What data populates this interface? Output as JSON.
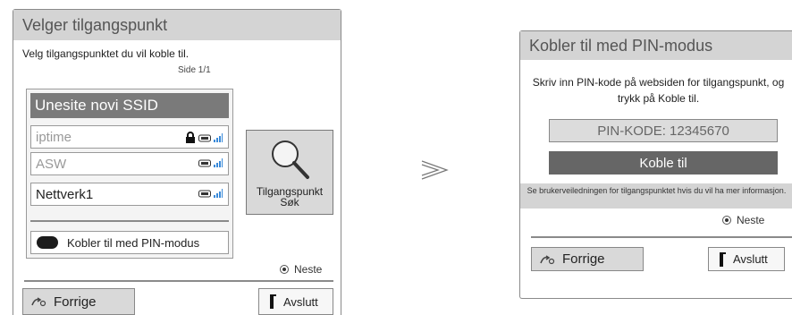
{
  "left_dialog": {
    "title": "Velger tilgangspunkt",
    "prompt": "Velg tilgangspunktet du vil koble til.",
    "page_indicator": "Side 1/1",
    "selected_item": "Unesite novi SSID",
    "access_points": [
      {
        "name": "iptime",
        "locked": true
      },
      {
        "name": "ASW",
        "locked": false
      },
      {
        "name": "Nettverk1",
        "locked": false
      }
    ],
    "pin_mode_button": "Kobler til med PIN-modus",
    "search_button_line1": "Tilgangspunkt",
    "search_button_line2": "Søk",
    "next_label": "Neste",
    "back_button": "Forrige",
    "exit_button": "Avslutt"
  },
  "arrow_glyph": "⪢",
  "right_dialog": {
    "title": "Kobler til med PIN-modus",
    "instruction": "Skriv inn PIN-kode på websiden for tilgangspunkt, og trykk på Koble til.",
    "pin_field": "PIN-KODE: 12345670",
    "connect_button": "Koble til",
    "help_text": "Se brukerveiledningen for tilgangspunktet hvis du vil ha mer informasjon.",
    "next_label": "Neste",
    "back_button": "Forrige",
    "exit_button": "Avslutt"
  },
  "icons": [
    "lock-icon",
    "router-icon",
    "signal-icon",
    "search-icon",
    "remote-back-icon",
    "exit-bracket-icon",
    "radio-icon"
  ],
  "colors": {
    "titlebar": "#d4d4d4",
    "selected": "#7a7a7a",
    "connect": "#666666",
    "button": "#d9d9d9"
  }
}
